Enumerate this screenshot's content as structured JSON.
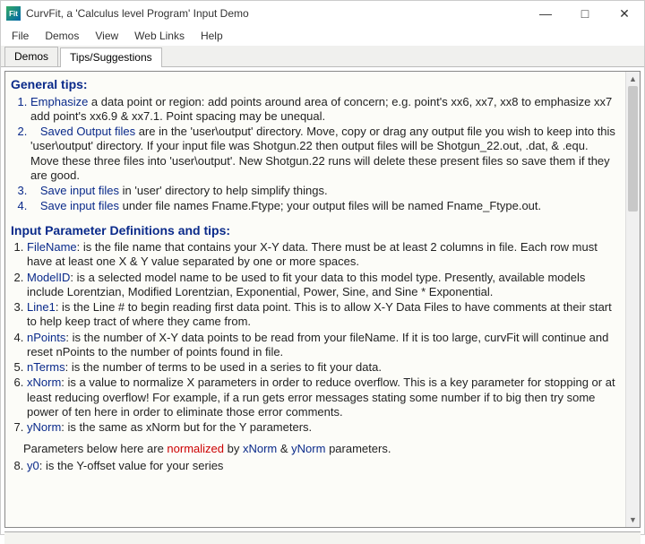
{
  "window": {
    "app_icon": "Fit",
    "title": "CurvFit, a 'Calculus level Program' Input Demo",
    "min": "—",
    "max": "□",
    "close": "✕"
  },
  "menu": {
    "file": "File",
    "demos": "Demos",
    "view": "View",
    "weblinks": "Web Links",
    "help": "Help"
  },
  "tabs": {
    "demos": "Demos",
    "tips": "Tips/Suggestions"
  },
  "tips_head": "General tips",
  "tips": {
    "t1_kw": "Emphasize",
    "t1_body": " a data point or region: add points around area of concern; e.g. point's xx6, xx7, xx8 to emphasize xx7 add point's xx6.9 & xx7.1.  Point spacing may be unequal.",
    "t2_kw": "Saved Output files",
    "t2_body1": " are in the 'user\\output' directory.  Move, copy or drag any output file you wish to keep into this 'user\\output' directory.  If your input file was Shotgun.22 then output files will be Shotgun_22.out, .dat, & .equ.  Move these three files into 'user\\output'.  New Shotgun.22 runs will delete these present files so save them if they are good.",
    "t3_kw": "Save input files",
    "t3_body": " in 'user' directory to help simplify things.",
    "t4_kw": "Save input files",
    "t4_body": " under file names Fname.Ftype; your output files will be named Fname_Ftype.out."
  },
  "defs_head": "Input Parameter Definitions and tips",
  "defs": {
    "d1_kw": "FileName",
    "d1_body": ": is the file name that contains your X-Y data. There must be at least 2 columns in file. Each row must have at least one X & Y value separated by one or more spaces.",
    "d2_kw": "ModelID",
    "d2_body": ": is a selected model name to be used to fit your data to this model type.  Presently, available models include Lorentzian, Modified Lorentzian, Exponential, Power, Sine, and Sine * Exponential.",
    "d3_kw": "Line1",
    "d3_body": ": is the Line # to begin reading first data point.  This is to allow X-Y Data Files to have comments at their start to help keep tract of where they came from.",
    "d4_kw": "nPoints",
    "d4_body": ": is the number of X-Y data points to be read from your fileName.  If it is too large, curvFit will continue and reset nPoints to the number of points found in file.",
    "d5_kw": "nTerms",
    "d5_body": ": is the number of terms to be used in a series to fit your data.",
    "d6_kw": "xNorm",
    "d6_body": ": is a value to normalize X parameters in order to reduce overflow.  This is a key parameter for stopping or at least reducing overflow!  For example, if a run gets error messages stating some number if to big then try some power of ten here in order to eliminate those error comments.",
    "d7_kw": "yNorm",
    "d7_body": ": is the same as xNorm but for the Y parameters.",
    "d8_kw": "y0",
    "d8_body": ": is the Y-offset value for your series"
  },
  "params_line": {
    "pre": "Parameters below here are ",
    "norm": "normalized",
    "mid": " by ",
    "xn": "xNorm",
    "amp": " & ",
    "yn": "yNorm",
    "post": " parameters."
  },
  "colon": ":"
}
